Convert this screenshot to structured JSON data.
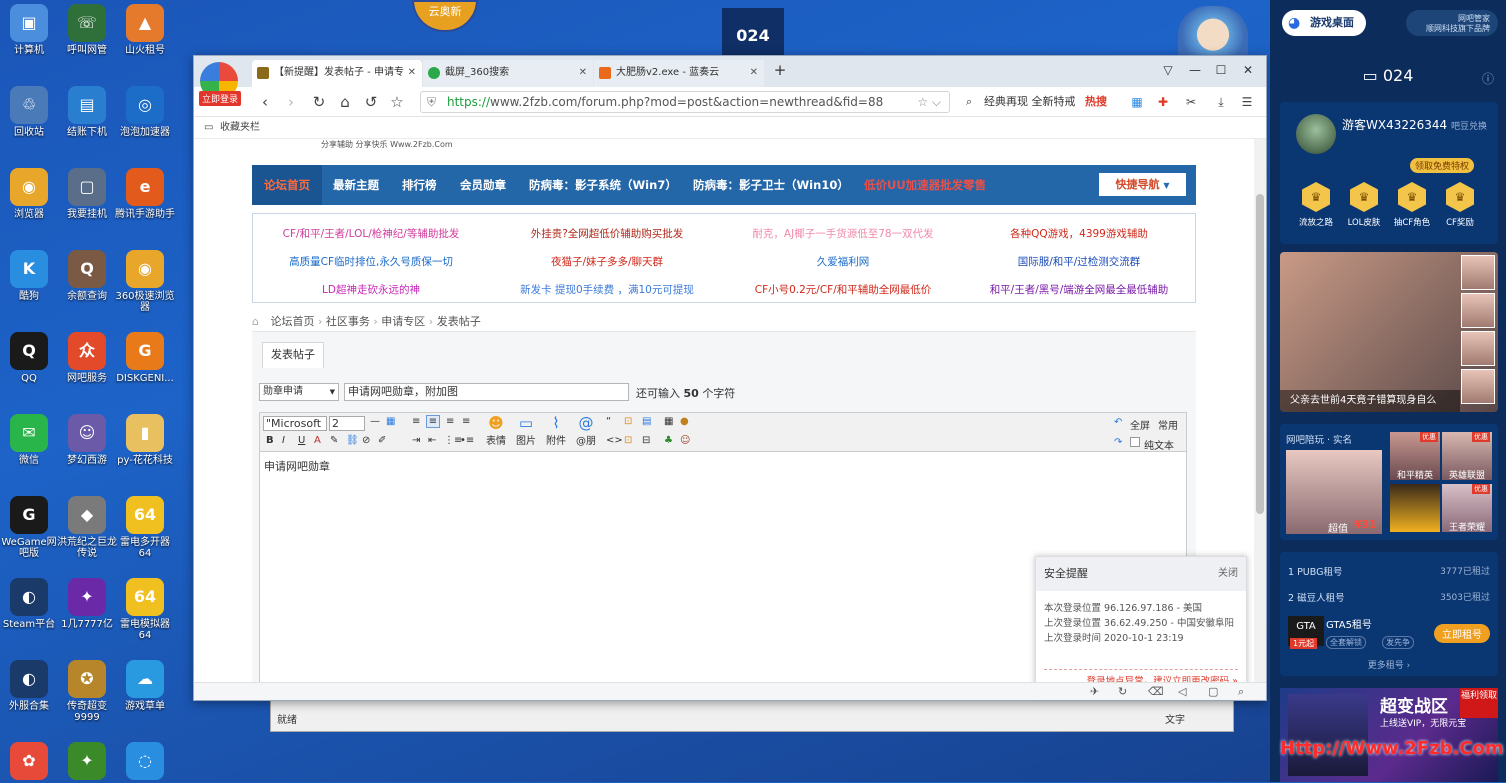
{
  "desktop": {
    "icons": [
      {
        "label": "计算机",
        "color": "#4c8ede",
        "glyph": "▣"
      },
      {
        "label": "呼叫网管",
        "color": "#2f6f3a",
        "glyph": "☏"
      },
      {
        "label": "山火租号",
        "color": "#e57a2c",
        "glyph": "▲"
      },
      {
        "label": "回收站",
        "color": "#4a7ab8",
        "glyph": "♲"
      },
      {
        "label": "结账下机",
        "color": "#2a7ecf",
        "glyph": "▤"
      },
      {
        "label": "泡泡加速器",
        "color": "#1c6dc7",
        "glyph": "◎"
      },
      {
        "label": "浏览器",
        "color": "#e8a62a",
        "glyph": "◉"
      },
      {
        "label": "我要挂机",
        "color": "#5a6e8a",
        "glyph": "▢"
      },
      {
        "label": "腾讯手游助手",
        "color": "#e25a1c",
        "glyph": "e"
      },
      {
        "label": "酷狗",
        "color": "#2a8ee0",
        "glyph": "K"
      },
      {
        "label": "余额查询",
        "color": "#7a5a45",
        "glyph": "Q"
      },
      {
        "label": "360极速浏览器",
        "color": "#e8a62a",
        "glyph": "◉"
      },
      {
        "label": "QQ",
        "color": "#1a1a1a",
        "glyph": "Q"
      },
      {
        "label": "网吧服务",
        "color": "#e24a2a",
        "glyph": "众"
      },
      {
        "label": "DISKGENI...",
        "color": "#e87a1a",
        "glyph": "G"
      },
      {
        "label": "微信",
        "color": "#2ab54a",
        "glyph": "✉"
      },
      {
        "label": "梦幻西游",
        "color": "#6a5aa8",
        "glyph": "☺"
      },
      {
        "label": "py-花花科技",
        "color": "#e8c060",
        "glyph": "▮"
      },
      {
        "label": "WeGame网吧版",
        "color": "#1a1a1a",
        "glyph": "G"
      },
      {
        "label": "洪荒纪之巨龙传说",
        "color": "#7a7a7a",
        "glyph": "◆"
      },
      {
        "label": "雷电多开器64",
        "color": "#f0c020",
        "glyph": "64"
      },
      {
        "label": "Steam平台",
        "color": "#1a3a6a",
        "glyph": "◐"
      },
      {
        "label": "1几7777亿",
        "color": "#6a2aa8",
        "glyph": "✦"
      },
      {
        "label": "雷电模拟器64",
        "color": "#f0c020",
        "glyph": "64"
      },
      {
        "label": "外服合集",
        "color": "#1a3a6a",
        "glyph": "◐"
      },
      {
        "label": "传奇超变9999",
        "color": "#b8862a",
        "glyph": "✪"
      },
      {
        "label": "游戏草单",
        "color": "#2a9ae0",
        "glyph": "☁"
      },
      {
        "label": "",
        "color": "#e84a3a",
        "glyph": "✿"
      },
      {
        "label": "",
        "color": "#3a8a2a",
        "glyph": "✦"
      },
      {
        "label": "",
        "color": "#2a8ee0",
        "glyph": "◌"
      }
    ]
  },
  "pc_number": "024",
  "top_badge": "云奥新",
  "browser": {
    "login_button": "立即登录",
    "tabs": [
      {
        "title": "【新提醒】发表帖子 - 申请专",
        "color": "#8a6a1a"
      },
      {
        "title": "截屏_360搜索",
        "color": "#2aa84a"
      },
      {
        "title": "大肥肠v2.exe - 蓝奏云",
        "color": "#e86a1a"
      }
    ],
    "new_tab": "+",
    "url_scheme": "https://",
    "url_rest": "www.2fzb.com/forum.php?mod=post&action=newthread&fid=88",
    "search_text": "经典再现 全新特戒",
    "hot_search": "热搜",
    "bookmark_label": "收藏夹栏",
    "window_buttons": {
      "minimize": "—",
      "maximize": "☐",
      "close": "✕",
      "skin": "▽"
    }
  },
  "page": {
    "slogan": "分享辅助 分享快乐 Www.2Fzb.Com",
    "nav": [
      "论坛首页",
      "最新主题",
      "排行榜",
      "会员勋章",
      "防病毒：影子系统（Win7）",
      "防病毒：影子卫士（Win10）",
      "低价UU加速器批发零售"
    ],
    "quick_nav": "快捷导航",
    "ads": [
      {
        "text": "CF/和平/王者/LOL/枪神纪/等辅助批发",
        "color": "#d03a9a"
      },
      {
        "text": "外挂贵?全网超低价辅助购买批发",
        "color": "#b0281a"
      },
      {
        "text": "耐克，AJ椰子一手货源低至78一双代发",
        "color": "#f08aa8"
      },
      {
        "text": "各种QQ游戏，4399游戏辅助",
        "color": "#d0281a"
      },
      {
        "text": "高质量CF临时排位,永久号质保一切",
        "color": "#1a6ac8"
      },
      {
        "text": "夜猫子/妹子多多/聊天群",
        "color": "#d0281a"
      },
      {
        "text": "久爱福利网",
        "color": "#1a6ac8"
      },
      {
        "text": "国际服/和平/过检测交流群",
        "color": "#1a4ab8"
      },
      {
        "text": "LD超神走砍永远的神",
        "color": "#c828b8"
      },
      {
        "text": "新发卡 提现0手续费 ，满10元可提现",
        "color": "#3a7ad8"
      },
      {
        "text": "CF小号0.2元/CF/和平辅助全网最低价",
        "color": "#d0281a"
      },
      {
        "text": "和平/王者/黑号/端游全网最全最低辅助",
        "color": "#7a1aa8"
      }
    ],
    "breadcrumb": [
      "论坛首页",
      "社区事务",
      "申请专区",
      "发表帖子"
    ],
    "post_tab": "发表帖子",
    "type_select": "勋章申请",
    "subject": "申请网吧勋章，附加图",
    "char_hint_before": "还可输入",
    "char_hint_count": "50",
    "char_hint_after": "个字符",
    "toolbar": {
      "font": "\"Microsoft",
      "size": "2",
      "emoji": "表情",
      "image": "图片",
      "attach": "附件",
      "at": "@朋",
      "fullscreen": "全屏",
      "common": "常用",
      "plain": "纯文本"
    },
    "editor_text": "申请网吧勋章"
  },
  "security": {
    "title": "安全提醒",
    "close": "关闭",
    "lines": [
      "本次登录位置 96.126.97.186 - 美国",
      "上次登录位置 36.62.49.250 - 中国安徽阜阳",
      "上次登录时间 2020-10-1 23:19"
    ],
    "warning": "登录地点异常，建议立即更改密码 »"
  },
  "behind_window": {
    "status": "就绪",
    "text_label": "文字"
  },
  "sidebar": {
    "game_desktop": "游戏桌面",
    "netbar_line1": "网吧管家",
    "netbar_line2": "顺网科技旗下品牌",
    "pc": "024",
    "username": "游客WX43226344",
    "username_sub": "吧豆兑换",
    "vip": "领取免费特权",
    "perks": [
      "流放之路",
      "LOL皮肤",
      "抽CF角色",
      "CF奖励"
    ],
    "video_title": "父亲去世前4天竟子错算现身自么",
    "play": {
      "tag": "网吧陪玩 · 实名",
      "items": [
        "和平精英",
        "英雄联盟",
        "王者荣耀"
      ],
      "price_label": "超值",
      "price": "¥31",
      "badge": "优惠"
    },
    "rent": [
      {
        "name": "1 PUBG租号",
        "count": "3777已租过"
      },
      {
        "name": "2 磁豆人租号",
        "count": "3503已租过"
      }
    ],
    "rent_game": "GTA5租号",
    "rent_price": "1元起",
    "rent_tags": [
      "全套解锁",
      "发先争"
    ],
    "rent_button": "立即租号",
    "more": "更多租号 ›",
    "ad_title": "超变战区",
    "ad_sub": "上线送VIP，无限元宝",
    "ad_corner": "福利领取"
  },
  "watermark": "Http://Www.2Fzb.Com"
}
